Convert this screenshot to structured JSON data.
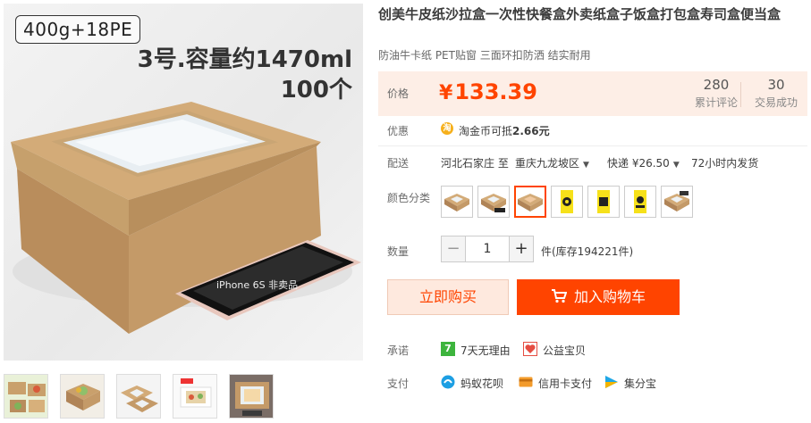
{
  "gallery": {
    "spec_tag": "400g+18PE",
    "caption_line1": "3号.容量约1470ml",
    "caption_line2": "100个",
    "phone_label": "iPhone 6S 非卖品",
    "thumbnails": [
      "thumb-1",
      "thumb-2",
      "thumb-3",
      "thumb-4",
      "thumb-5"
    ]
  },
  "product": {
    "title": "创美牛皮纸沙拉盒一次性快餐盒外卖纸盒子饭盒打包盒寿司盒便当盒",
    "subtitle": "防油牛卡纸 PET贴窗 三面环扣防洒 结实耐用"
  },
  "price": {
    "label": "价格",
    "currency": "¥",
    "amount": "133.39",
    "reviews_count": "280",
    "reviews_label": "累计评论",
    "sales_count": "30",
    "sales_label": "交易成功"
  },
  "discount": {
    "label": "优惠",
    "coin_text": "淘金币可抵",
    "coin_amount": "2.66元"
  },
  "shipping": {
    "label": "配送",
    "from": "河北石家庄 至",
    "to": "重庆九龙坡区",
    "method": "快递 ¥26.50",
    "time": "72小时内发货"
  },
  "color": {
    "label": "颜色分类",
    "selected_index": 2,
    "options": [
      "kraft-window",
      "kraft-window-phone",
      "kraft-window-orange",
      "label-yellow-1",
      "label-yellow-2",
      "label-yellow-3",
      "kraft-window-dark"
    ]
  },
  "quantity": {
    "label": "数量",
    "value": "1",
    "minus": "−",
    "plus": "+",
    "stock_text": "件(库存194221件)"
  },
  "actions": {
    "buy_now": "立即购买",
    "add_to_cart": "加入购物车"
  },
  "promise": {
    "label": "承诺",
    "items": [
      "7天无理由",
      "公益宝贝"
    ]
  },
  "payment": {
    "label": "支付",
    "items": [
      "蚂蚁花呗",
      "信用卡支付",
      "集分宝"
    ]
  },
  "colors": {
    "accent": "#ff4400",
    "price_bg": "#fdeee6",
    "buy_bg": "#fee9de"
  }
}
